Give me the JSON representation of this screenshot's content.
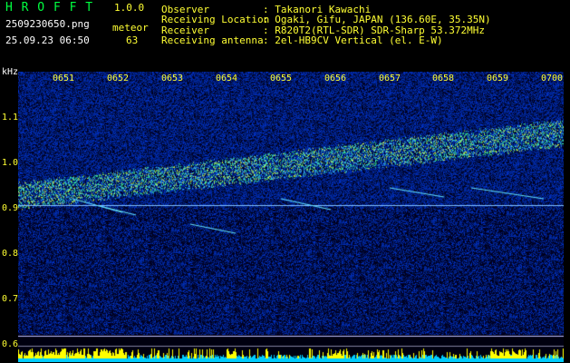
{
  "app": {
    "name": "H R O F F T",
    "version": "1.0.0",
    "filename": "2509230650.png",
    "datetime": "25.09.23 06:50",
    "meteor_label": "meteor",
    "meteor_count": "63"
  },
  "info": {
    "rows": [
      {
        "label": "Observer",
        "value": ": Takanori Kawachi"
      },
      {
        "label": "Receiving Location",
        "value": ": Ogaki, Gifu, JAPAN (136.60E, 35.35N)"
      },
      {
        "label": "Receiver",
        "value": ": R820T2(RTL-SDR) SDR-Sharp 53.372MHz"
      },
      {
        "label": "Receiving antenna",
        "value": ": 2el-HB9CV Vertical (el. E-W)"
      }
    ]
  },
  "axes": {
    "unit": "kHz",
    "time_ticks": [
      "0651",
      "0652",
      "0653",
      "0654",
      "0655",
      "0656",
      "0657",
      "0658",
      "0659",
      "0700"
    ],
    "freq_ticks": [
      "1.1",
      "1.0",
      "0.9",
      "0.8",
      "0.7",
      "0.6"
    ]
  },
  "colors": {
    "background": "#000000",
    "label_yellow": "#ffff33",
    "label_green": "#00ff40",
    "noise_blue": "#1030c0",
    "trace_cyan": "#40e0ff",
    "level_cyan": "#00ccff",
    "level_yellow": "#ffff00"
  }
}
